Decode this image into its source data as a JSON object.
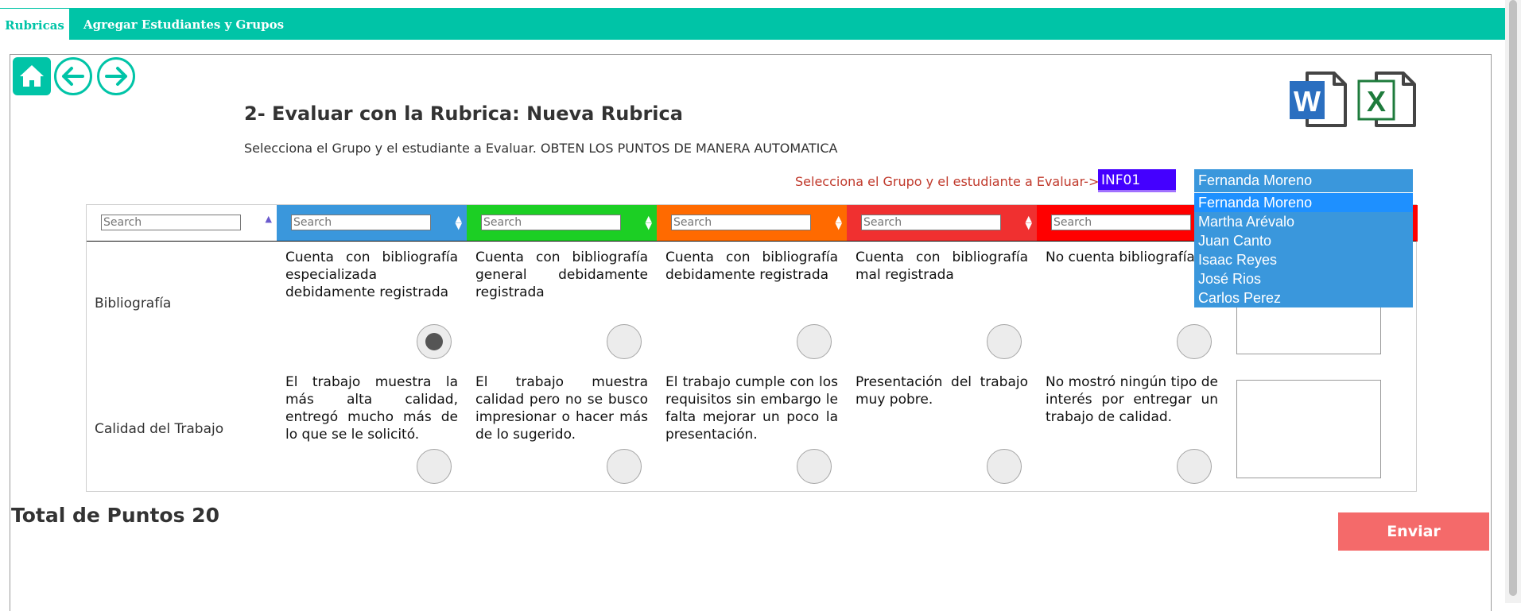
{
  "tabs": [
    {
      "label": "Rubricas",
      "active": true
    },
    {
      "label": "Agregar Estudiantes y Grupos",
      "active": false
    }
  ],
  "header": {
    "title": "2- Evaluar con la Rubrica: Nueva Rubrica",
    "subtitle": "Selecciona el Grupo y el estudiante a Evaluar. OBTEN LOS PUNTOS DE MANERA AUTOMATICA"
  },
  "icons": {
    "home": "home-icon",
    "back": "arrow-left-icon",
    "forward": "arrow-right-icon",
    "word": "word-icon",
    "excel": "excel-icon",
    "word_letter": "W",
    "excel_letter": "X"
  },
  "selector": {
    "label": "Selecciona el Grupo y el estudiante a Evaluar->",
    "group": "INF01",
    "student_selected": "Fernanda Moreno",
    "students": [
      "Fernanda Moreno",
      "Martha Arévalo",
      "Juan Canto",
      "Isaac Reyes",
      "José Rios",
      "Carlos Perez"
    ]
  },
  "table": {
    "search_placeholder": "Search",
    "header_colors": [
      "#ffffff",
      "#3a97dc",
      "#1ccf24",
      "#ff6a00",
      "#f03030",
      "#ff0000"
    ],
    "rows": [
      {
        "criterion": "Bibliografía",
        "cells": [
          "Cuenta con bibliografía especializada debidamente registrada",
          "Cuenta con bibliografía general debidamente registrada",
          "Cuenta con bibliografía debidamente registrada",
          "Cuenta con bibliografía mal registrada",
          "No cuenta bibliografía"
        ],
        "selected_index": 0
      },
      {
        "criterion": "Calidad del Trabajo",
        "cells": [
          "El trabajo muestra la más alta calidad, entregó mucho más de lo que se le solicitó.",
          "El trabajo muestra calidad pero no se busco impresionar o hacer más de lo sugerido.",
          "El trabajo cumple con los requisitos sin embargo le falta mejorar un poco la presentación.",
          "Presentación del trabajo muy pobre.",
          "No mostró ningún tipo de interés por entregar un trabajo de calidad."
        ],
        "selected_index": -1
      }
    ]
  },
  "footer": {
    "total": "Total de Puntos 20",
    "submit": "Enviar"
  },
  "colors": {
    "accent": "#00c4a7",
    "submit": "#f46a6a",
    "group_box": "#4400ff",
    "student_select": "#3a97dc"
  }
}
